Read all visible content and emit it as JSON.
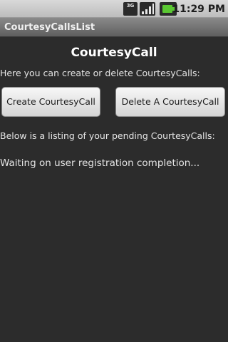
{
  "status_bar": {
    "network_label": "3G",
    "time": "11:29 PM",
    "icons": [
      "network-3g-icon",
      "signal-strength-icon",
      "battery-icon"
    ],
    "battery_color": "#5ac832"
  },
  "title_bar": {
    "title": "CourtesyCallsList"
  },
  "main": {
    "heading": "CourtesyCall",
    "intro": "Here you can create or delete CourtesyCalls:",
    "create_button_label": "Create CourtesyCall",
    "delete_button_label": "Delete A CourtesyCall",
    "listing_label": "Below is a listing of your pending CourtesyCalls:",
    "status_message": "Waiting on user registration completion..."
  },
  "colors": {
    "background": "#2c2c2c",
    "text": "#e6e6e6"
  }
}
